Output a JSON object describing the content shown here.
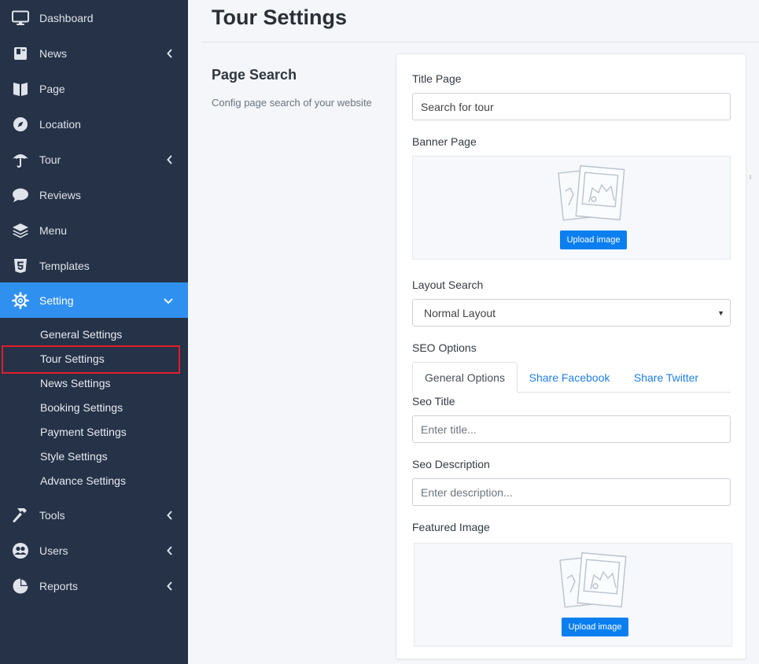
{
  "sidebar": {
    "items": [
      {
        "label": "Dashboard",
        "icon": "monitor-icon",
        "has_chevron": false
      },
      {
        "label": "News",
        "icon": "book-icon",
        "has_chevron": true
      },
      {
        "label": "Page",
        "icon": "pages-icon",
        "has_chevron": false
      },
      {
        "label": "Location",
        "icon": "compass-icon",
        "has_chevron": false
      },
      {
        "label": "Tour",
        "icon": "umbrella-icon",
        "has_chevron": true
      },
      {
        "label": "Reviews",
        "icon": "comment-icon",
        "has_chevron": false
      },
      {
        "label": "Menu",
        "icon": "layers-icon",
        "has_chevron": false
      },
      {
        "label": "Templates",
        "icon": "html5-icon",
        "has_chevron": false
      },
      {
        "label": "Setting",
        "icon": "gear-icon",
        "has_chevron": true,
        "active": true
      }
    ],
    "submenu": [
      {
        "label": "General Settings"
      },
      {
        "label": "Tour Settings",
        "highlighted": true
      },
      {
        "label": "News Settings"
      },
      {
        "label": "Booking Settings"
      },
      {
        "label": "Payment Settings"
      },
      {
        "label": "Style Settings"
      },
      {
        "label": "Advance Settings"
      }
    ],
    "bottom_items": [
      {
        "label": "Tools",
        "icon": "hammer-icon",
        "has_chevron": true
      },
      {
        "label": "Users",
        "icon": "users-icon",
        "has_chevron": true
      },
      {
        "label": "Reports",
        "icon": "pie-chart-icon",
        "has_chevron": true
      }
    ]
  },
  "header": {
    "title": "Tour Settings"
  },
  "section": {
    "title": "Page Search",
    "description": "Config page search of your website"
  },
  "form": {
    "title_page_label": "Title Page",
    "title_page_value": "Search for tour",
    "banner_label": "Banner Page",
    "upload_label": "Upload image",
    "layout_label": "Layout Search",
    "layout_value": "Normal Layout",
    "seo_label": "SEO Options",
    "tabs": [
      {
        "label": "General Options"
      },
      {
        "label": "Share Facebook"
      },
      {
        "label": "Share Twitter"
      }
    ],
    "seo_title_label": "Seo Title",
    "seo_title_placeholder": "Enter title...",
    "seo_desc_label": "Seo Description",
    "seo_desc_placeholder": "Enter description...",
    "featured_label": "Featured Image",
    "featured_upload_label": "Upload image"
  },
  "colors": {
    "sidebar_bg": "#253247",
    "active_bg": "#3090f0",
    "accent": "#0b7ff0",
    "highlight_border": "#e11d2a"
  }
}
